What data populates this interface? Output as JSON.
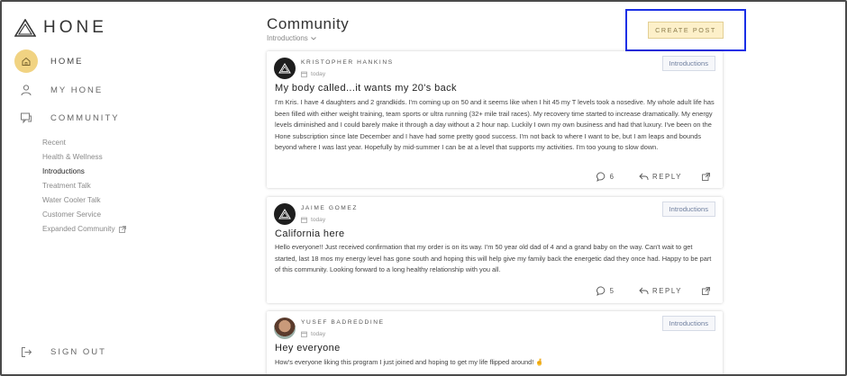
{
  "app": {
    "brand": "HONE"
  },
  "sidebar": {
    "nav": [
      {
        "label": "HOME",
        "icon": "home-icon"
      },
      {
        "label": "MY HONE",
        "icon": "user-icon"
      },
      {
        "label": "COMMUNITY",
        "icon": "chat-icon"
      }
    ],
    "community_links": [
      "Recent",
      "Health & Wellness",
      "Introductions",
      "Treatment Talk",
      "Water Cooler Talk",
      "Customer Service",
      "Expanded Community"
    ],
    "sign_out": "SIGN OUT"
  },
  "header": {
    "title": "Community",
    "filter": "Introductions",
    "create_post": "CREATE POST"
  },
  "posts": [
    {
      "author": "KRISTOPHER HANKINS",
      "date": "today",
      "category": "Introductions",
      "title": "My body called...it wants my 20's back",
      "body": "I'm Kris. I have 4 daughters and 2 grandkids. I'm coming up on 50 and it seems like when I hit 45 my T levels took a nosedive. My whole adult life has been filled with either weight training, team sports or ultra running (32+ mile trail races). My recovery time started to increase dramatically. My energy levels diminished and I could barely make it through a day without a 2 hour nap. Luckily I own my own business and had that luxury. I've been on the Hone subscription since late December and I have had some pretty good success. I'm not back to where I want to be, but I am leaps and bounds beyond where I was last year. Hopefully by mid-summer I can be at a level that supports my activities. I'm too young to slow down.",
      "comments": "6",
      "reply": "REPLY"
    },
    {
      "author": "JAIME GOMEZ",
      "date": "today",
      "category": "Introductions",
      "title": "California here",
      "body": "Hello everyone!! Just received confirmation that my order is on its way. I'm 50 year old dad of 4 and a grand baby on the way. Can't wait to get started, last 18 mos my energy level has gone south and hoping this will help give my family back the energetic dad they once had. Happy to be part of this community. Looking forward to a long healthy relationship with you all.",
      "comments": "5",
      "reply": "REPLY"
    },
    {
      "author": "YUSEF BADREDDINE",
      "date": "today",
      "category": "Introductions",
      "title": "Hey everyone",
      "body": "How's everyone liking this program I just joined and hoping to get my life flipped around! 🤞"
    }
  ],
  "colors": {
    "accent": "#f1d382",
    "highlight_box": "#1a2fe6",
    "badge_text": "#6f7f9f"
  }
}
